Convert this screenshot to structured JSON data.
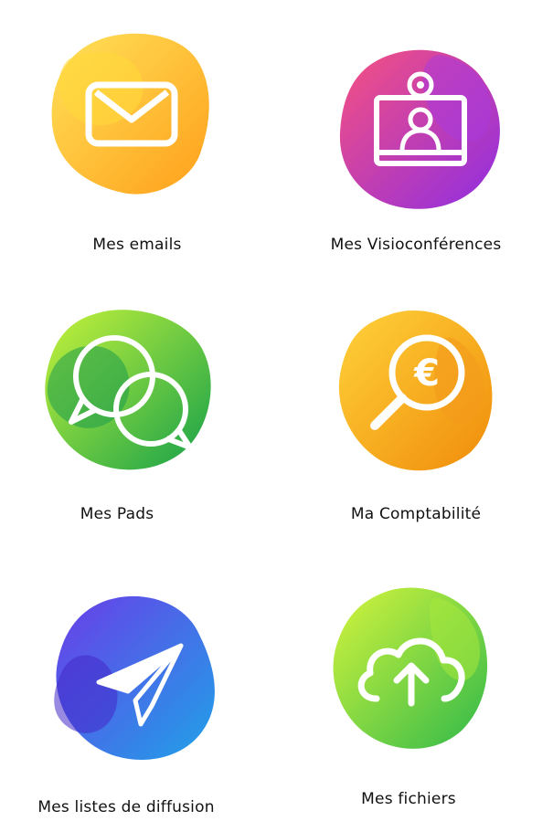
{
  "apps": [
    {
      "label": "Mes emails",
      "icon": "envelope-icon",
      "colors": [
        "#ffe259",
        "#ff9f1a"
      ]
    },
    {
      "label": "Mes Visioconférences",
      "icon": "video-conference-icon",
      "colors": [
        "#f7517f",
        "#8e2de2"
      ]
    },
    {
      "label": "Mes Pads",
      "icon": "chat-bubbles-icon",
      "colors": [
        "#c7f33a",
        "#14a04a"
      ]
    },
    {
      "label": "Ma Comptabilité",
      "icon": "euro-magnifier-icon",
      "colors": [
        "#ffd23a",
        "#f08c0a"
      ]
    },
    {
      "label": "Mes listes de diffusion",
      "icon": "paper-plane-icon",
      "colors": [
        "#6a3de8",
        "#1fa2e8"
      ]
    },
    {
      "label": "Mes fichiers",
      "icon": "cloud-upload-icon",
      "colors": [
        "#d6f53c",
        "#2fb94a"
      ]
    }
  ]
}
